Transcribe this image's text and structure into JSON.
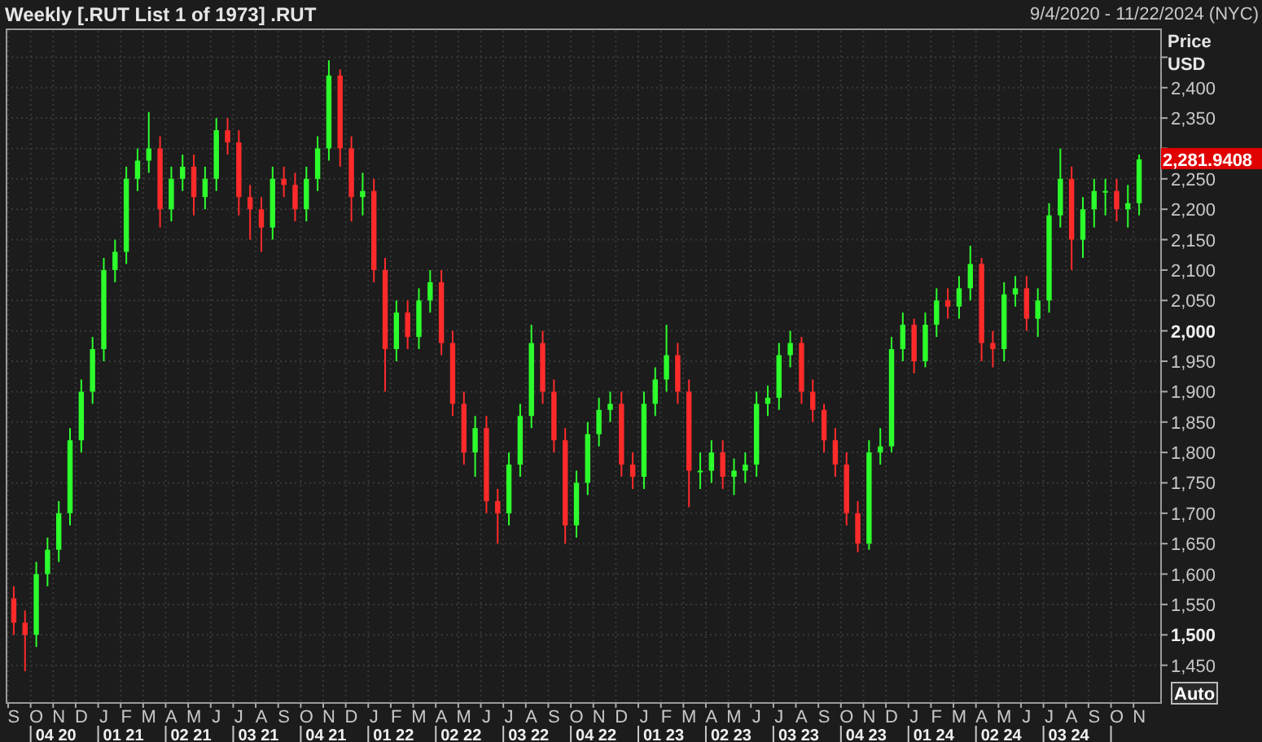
{
  "header": {
    "title": "Weekly [.RUT List 1 of 1973] .RUT",
    "date_range": "9/4/2020 - 11/22/2024 (NYC)"
  },
  "price_axis": {
    "title": "Price",
    "currency": "USD",
    "last_price_label": "2,281.9408",
    "auto_button": "Auto"
  },
  "quarters": [
    "04 20",
    "01 21",
    "02 21",
    "03 21",
    "04 21",
    "01 22",
    "02 22",
    "03 22",
    "04 22",
    "01 23",
    "02 23",
    "03 23",
    "04 23",
    "01 24",
    "02 24",
    "03 24"
  ],
  "chart": {
    "chart_data": {
      "type": "candlestick",
      "grid": true,
      "categories": [
        "S",
        null,
        "O",
        null,
        "N",
        null,
        "D",
        null,
        "J",
        null,
        "F",
        null,
        "M",
        null,
        "A",
        null,
        "M",
        null,
        "J",
        null,
        "J",
        null,
        "A",
        null,
        "S",
        null,
        "O",
        null,
        "N",
        null,
        "D",
        null,
        "J",
        null,
        "F",
        null,
        "M",
        null,
        "A",
        null,
        "M",
        null,
        "J",
        null,
        "J",
        null,
        "A",
        null,
        "S",
        null,
        "O",
        null,
        "N",
        null,
        "D",
        null,
        "J",
        null,
        "F",
        null,
        "M",
        null,
        "A",
        null,
        "M",
        null,
        "J",
        null,
        "J",
        null,
        "A",
        null,
        "S",
        null,
        "O",
        null,
        "N",
        null,
        "D",
        null,
        "J",
        null,
        "F",
        null,
        "M",
        null,
        "A",
        null,
        "M",
        null,
        "J",
        null,
        "J",
        null,
        "A",
        null,
        "S",
        null,
        "O",
        null,
        "N"
      ],
      "ylim": [
        1388,
        2496
      ],
      "yticks": [
        {
          "value": 1450,
          "label": "1,450"
        },
        {
          "value": 1500,
          "label": "1,500"
        },
        {
          "value": 1550,
          "label": "1,550"
        },
        {
          "value": 1600,
          "label": "1,600"
        },
        {
          "value": 1650,
          "label": "1,650"
        },
        {
          "value": 1700,
          "label": "1,700"
        },
        {
          "value": 1750,
          "label": "1,750"
        },
        {
          "value": 1800,
          "label": "1,800"
        },
        {
          "value": 1850,
          "label": "1,850"
        },
        {
          "value": 1900,
          "label": "1,900"
        },
        {
          "value": 1950,
          "label": "1,950"
        },
        {
          "value": 2000,
          "label": "2,000"
        },
        {
          "value": 2050,
          "label": "2,050"
        },
        {
          "value": 2100,
          "label": "2,100"
        },
        {
          "value": 2150,
          "label": "2,150"
        },
        {
          "value": 2200,
          "label": "2,200"
        },
        {
          "value": 2250,
          "label": "2,250"
        },
        {
          "value": 2350,
          "label": "2,350"
        },
        {
          "value": 2400,
          "label": "2,400"
        }
      ],
      "ohlc": [
        [
          1560,
          1580,
          1500,
          1520
        ],
        [
          1520,
          1540,
          1440,
          1500
        ],
        [
          1500,
          1620,
          1480,
          1600
        ],
        [
          1600,
          1660,
          1580,
          1640
        ],
        [
          1640,
          1720,
          1620,
          1700
        ],
        [
          1700,
          1840,
          1680,
          1820
        ],
        [
          1820,
          1920,
          1800,
          1900
        ],
        [
          1900,
          1990,
          1880,
          1970
        ],
        [
          1970,
          2120,
          1950,
          2100
        ],
        [
          2100,
          2150,
          2080,
          2130
        ],
        [
          2130,
          2270,
          2110,
          2250
        ],
        [
          2250,
          2300,
          2230,
          2280
        ],
        [
          2280,
          2360,
          2260,
          2300
        ],
        [
          2300,
          2320,
          2170,
          2200
        ],
        [
          2200,
          2270,
          2180,
          2250
        ],
        [
          2250,
          2290,
          2230,
          2270
        ],
        [
          2270,
          2290,
          2190,
          2220
        ],
        [
          2220,
          2270,
          2200,
          2250
        ],
        [
          2250,
          2350,
          2230,
          2330
        ],
        [
          2330,
          2350,
          2290,
          2310
        ],
        [
          2310,
          2330,
          2190,
          2220
        ],
        [
          2220,
          2240,
          2150,
          2200
        ],
        [
          2200,
          2220,
          2130,
          2170
        ],
        [
          2170,
          2270,
          2150,
          2250
        ],
        [
          2250,
          2270,
          2220,
          2240
        ],
        [
          2240,
          2260,
          2180,
          2200
        ],
        [
          2200,
          2270,
          2180,
          2250
        ],
        [
          2250,
          2320,
          2230,
          2300
        ],
        [
          2300,
          2445,
          2280,
          2420
        ],
        [
          2420,
          2430,
          2270,
          2300
        ],
        [
          2300,
          2320,
          2180,
          2220
        ],
        [
          2220,
          2260,
          2190,
          2230
        ],
        [
          2230,
          2250,
          2080,
          2100
        ],
        [
          2100,
          2120,
          1900,
          1970
        ],
        [
          1970,
          2050,
          1950,
          2030
        ],
        [
          2030,
          2050,
          1970,
          1990
        ],
        [
          1990,
          2070,
          1970,
          2050
        ],
        [
          2050,
          2100,
          2030,
          2080
        ],
        [
          2080,
          2100,
          1960,
          1980
        ],
        [
          1980,
          2000,
          1860,
          1880
        ],
        [
          1880,
          1900,
          1780,
          1800
        ],
        [
          1800,
          1860,
          1760,
          1840
        ],
        [
          1840,
          1860,
          1700,
          1720
        ],
        [
          1720,
          1740,
          1650,
          1700
        ],
        [
          1700,
          1800,
          1680,
          1780
        ],
        [
          1780,
          1880,
          1760,
          1860
        ],
        [
          1860,
          2010,
          1840,
          1980
        ],
        [
          1980,
          2000,
          1880,
          1900
        ],
        [
          1900,
          1920,
          1800,
          1820
        ],
        [
          1820,
          1840,
          1650,
          1680
        ],
        [
          1680,
          1770,
          1660,
          1750
        ],
        [
          1750,
          1850,
          1730,
          1830
        ],
        [
          1830,
          1890,
          1810,
          1870
        ],
        [
          1870,
          1900,
          1850,
          1880
        ],
        [
          1880,
          1900,
          1760,
          1780
        ],
        [
          1780,
          1800,
          1740,
          1760
        ],
        [
          1760,
          1900,
          1740,
          1880
        ],
        [
          1880,
          1940,
          1860,
          1920
        ],
        [
          1920,
          2010,
          1900,
          1960
        ],
        [
          1960,
          1980,
          1880,
          1900
        ],
        [
          1900,
          1920,
          1710,
          1770
        ],
        [
          1770,
          1800,
          1740,
          1770
        ],
        [
          1770,
          1820,
          1750,
          1800
        ],
        [
          1800,
          1820,
          1740,
          1760
        ],
        [
          1760,
          1790,
          1730,
          1770
        ],
        [
          1770,
          1800,
          1750,
          1780
        ],
        [
          1780,
          1900,
          1760,
          1880
        ],
        [
          1880,
          1910,
          1860,
          1890
        ],
        [
          1890,
          1980,
          1870,
          1960
        ],
        [
          1960,
          2000,
          1940,
          1980
        ],
        [
          1980,
          1990,
          1880,
          1900
        ],
        [
          1900,
          1920,
          1850,
          1870
        ],
        [
          1870,
          1880,
          1800,
          1820
        ],
        [
          1820,
          1840,
          1760,
          1780
        ],
        [
          1780,
          1800,
          1680,
          1700
        ],
        [
          1700,
          1720,
          1636,
          1650
        ],
        [
          1650,
          1820,
          1640,
          1800
        ],
        [
          1800,
          1840,
          1780,
          1810
        ],
        [
          1810,
          1990,
          1800,
          1970
        ],
        [
          1970,
          2030,
          1950,
          2010
        ],
        [
          2010,
          2020,
          1930,
          1950
        ],
        [
          1950,
          2030,
          1940,
          2010
        ],
        [
          2010,
          2070,
          1990,
          2050
        ],
        [
          2050,
          2070,
          2020,
          2040
        ],
        [
          2040,
          2090,
          2020,
          2070
        ],
        [
          2070,
          2140,
          2050,
          2110
        ],
        [
          2110,
          2120,
          1950,
          1980
        ],
        [
          1980,
          2000,
          1940,
          1970
        ],
        [
          1970,
          2080,
          1950,
          2060
        ],
        [
          2060,
          2090,
          2040,
          2070
        ],
        [
          2070,
          2090,
          2000,
          2020
        ],
        [
          2020,
          2070,
          1990,
          2050
        ],
        [
          2050,
          2210,
          2030,
          2190
        ],
        [
          2190,
          2300,
          2170,
          2250
        ],
        [
          2250,
          2270,
          2100,
          2150
        ],
        [
          2150,
          2220,
          2120,
          2200
        ],
        [
          2200,
          2250,
          2170,
          2230
        ],
        [
          2230,
          2250,
          2190,
          2230
        ],
        [
          2230,
          2250,
          2180,
          2200
        ],
        [
          2200,
          2240,
          2170,
          2210
        ],
        [
          2210,
          2290,
          2190,
          2282
        ]
      ]
    }
  }
}
